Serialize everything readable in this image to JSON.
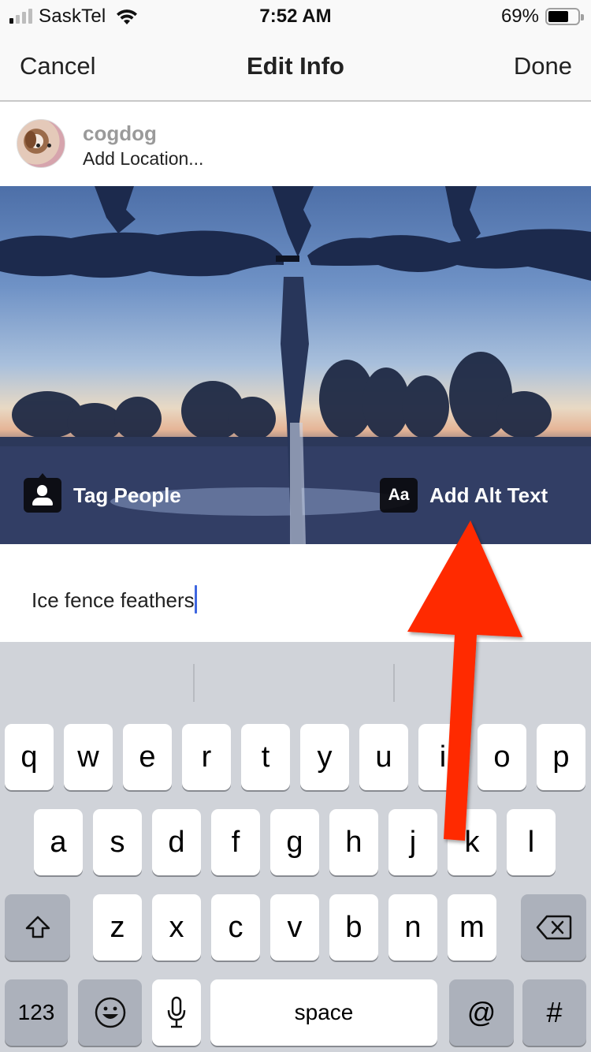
{
  "status_bar": {
    "carrier": "SaskTel",
    "signal_bars_active": 1,
    "signal_bars_total": 4,
    "time": "7:52 AM",
    "battery_percent": "69%",
    "battery_level": 0.69
  },
  "nav": {
    "cancel_label": "Cancel",
    "title": "Edit Info",
    "done_label": "Done"
  },
  "post_header": {
    "username": "cogdog",
    "location_placeholder": "Add Location..."
  },
  "photo": {
    "description": "Frost-covered barbed wire fence at sunset with trees",
    "tag_people_label": "Tag People",
    "alt_text_icon": "Aa",
    "alt_text_label": "Add Alt Text"
  },
  "caption": {
    "value": "Ice fence feathers"
  },
  "annotation": {
    "arrow_color": "#ff2a00",
    "points_to": "Add Alt Text"
  },
  "keyboard": {
    "row1": [
      "q",
      "w",
      "e",
      "r",
      "t",
      "y",
      "u",
      "i",
      "o",
      "p"
    ],
    "row2": [
      "a",
      "s",
      "d",
      "f",
      "g",
      "h",
      "j",
      "k",
      "l"
    ],
    "row3": [
      "z",
      "x",
      "c",
      "v",
      "b",
      "n",
      "m"
    ],
    "shift_icon": "shift-icon",
    "delete_icon": "backspace-icon",
    "numbers_label": "123",
    "emoji_icon": "emoji-icon",
    "mic_icon": "microphone-icon",
    "space_label": "space",
    "at_label": "@",
    "hash_label": "#"
  }
}
